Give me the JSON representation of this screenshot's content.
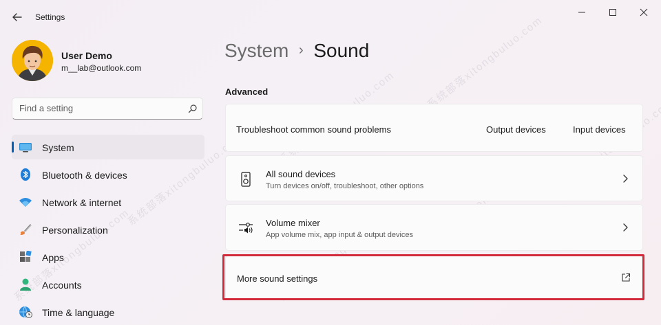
{
  "window": {
    "title": "Settings"
  },
  "profile": {
    "name": "User Demo",
    "email": "m__lab@outlook.com"
  },
  "search": {
    "placeholder": "Find a setting"
  },
  "nav": {
    "items": [
      {
        "label": "System",
        "icon": "monitor-icon",
        "active": true
      },
      {
        "label": "Bluetooth & devices",
        "icon": "bluetooth-icon"
      },
      {
        "label": "Network & internet",
        "icon": "wifi-icon"
      },
      {
        "label": "Personalization",
        "icon": "paintbrush-icon"
      },
      {
        "label": "Apps",
        "icon": "apps-icon"
      },
      {
        "label": "Accounts",
        "icon": "person-icon"
      },
      {
        "label": "Time & language",
        "icon": "globe-clock-icon"
      }
    ]
  },
  "breadcrumb": {
    "parent": "System",
    "separator": "›",
    "current": "Sound"
  },
  "section": {
    "title": "Advanced"
  },
  "troubleshoot": {
    "label": "Troubleshoot common sound problems",
    "link1": "Output devices",
    "link2": "Input devices"
  },
  "all_devices": {
    "title": "All sound devices",
    "subtitle": "Turn devices on/off, troubleshoot, other options"
  },
  "mixer": {
    "title": "Volume mixer",
    "subtitle": "App volume mix, app input & output devices"
  },
  "more_settings": {
    "label": "More sound settings"
  },
  "watermark": {
    "text": "系统部落xitongbuluo.com"
  },
  "colors": {
    "accent": "#005fb8",
    "highlight_border": "#d22a3a"
  }
}
